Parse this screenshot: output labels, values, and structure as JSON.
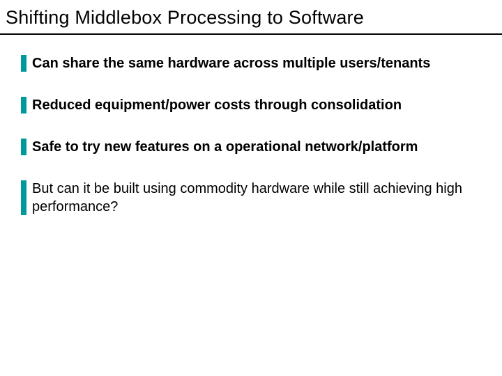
{
  "title": "Shifting Middlebox Processing to Software",
  "bullets": [
    {
      "text": "Can share the same hardware across multiple users/tenants",
      "bold": true
    },
    {
      "text": "Reduced equipment/power costs through consolidation",
      "bold": true
    },
    {
      "text": "Safe to try new features on a operational network/platform",
      "bold": true
    },
    {
      "text": "But can it be built using commodity hardware while still achieving high performance?",
      "bold": false
    }
  ],
  "accent_color": "#009999"
}
